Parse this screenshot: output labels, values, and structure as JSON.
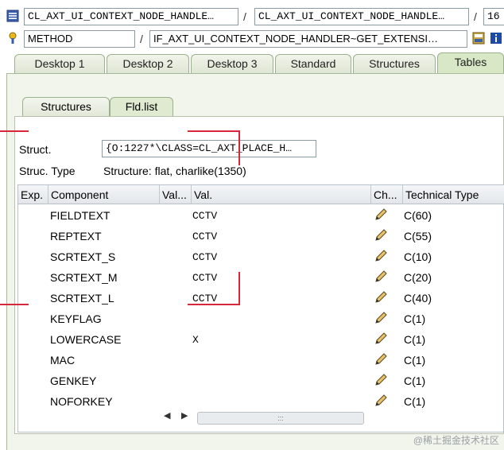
{
  "header": {
    "row1": {
      "class_field": "CL_AXT_UI_CONTEXT_NODE_HANDLE…",
      "class_field2": "CL_AXT_UI_CONTEXT_NODE_HANDLE…",
      "separator": "/",
      "num_field": "16"
    },
    "row2": {
      "type_field": "METHOD",
      "separator": "/",
      "method_field": "IF_AXT_UI_CONTEXT_NODE_HANDLER~GET_EXTENSI…"
    }
  },
  "main_tabs": [
    {
      "label": "Desktop 1"
    },
    {
      "label": "Desktop 2"
    },
    {
      "label": "Desktop 3"
    },
    {
      "label": "Standard"
    },
    {
      "label": "Structures"
    },
    {
      "label": "Tables",
      "active": true
    }
  ],
  "sub_tabs": [
    {
      "label": "Structures"
    },
    {
      "label": "Fld.list",
      "active": true
    }
  ],
  "struct": {
    "label": "Struct.",
    "value": "{O:1227*\\CLASS=CL_AXT_PLACE_H…",
    "type_label": "Struc. Type",
    "type_value": "Structure: flat, charlike(1350)"
  },
  "table": {
    "headers": [
      "Exp.",
      "Component",
      "Val...",
      "Val.",
      "Ch...",
      "Technical Type"
    ],
    "rows": [
      {
        "component": "FIELDTEXT",
        "val": "CCTV",
        "type": "C(60)"
      },
      {
        "component": "REPTEXT",
        "val": "CCTV",
        "type": "C(55)"
      },
      {
        "component": "SCRTEXT_S",
        "val": "CCTV",
        "type": "C(10)"
      },
      {
        "component": "SCRTEXT_M",
        "val": "CCTV",
        "type": "C(20)"
      },
      {
        "component": "SCRTEXT_L",
        "val": "CCTV",
        "type": "C(40)"
      },
      {
        "component": "KEYFLAG",
        "val": "",
        "type": "C(1)"
      },
      {
        "component": "LOWERCASE",
        "val": "X",
        "type": "C(1)"
      },
      {
        "component": "MAC",
        "val": "",
        "type": "C(1)"
      },
      {
        "component": "GENKEY",
        "val": "",
        "type": "C(1)"
      },
      {
        "component": "NOFORKEY",
        "val": "",
        "type": "C(1)"
      }
    ]
  },
  "scroll": {
    "left": "◀",
    "right": "▶",
    "grip": ":::"
  },
  "watermark": "@稀土掘金技术社区",
  "colors": {
    "tab_green": "#d8e7c6",
    "panel_bg": "#f1f5ec",
    "annotation_red": "#d8263a",
    "pencil": "#6b5a2a"
  }
}
